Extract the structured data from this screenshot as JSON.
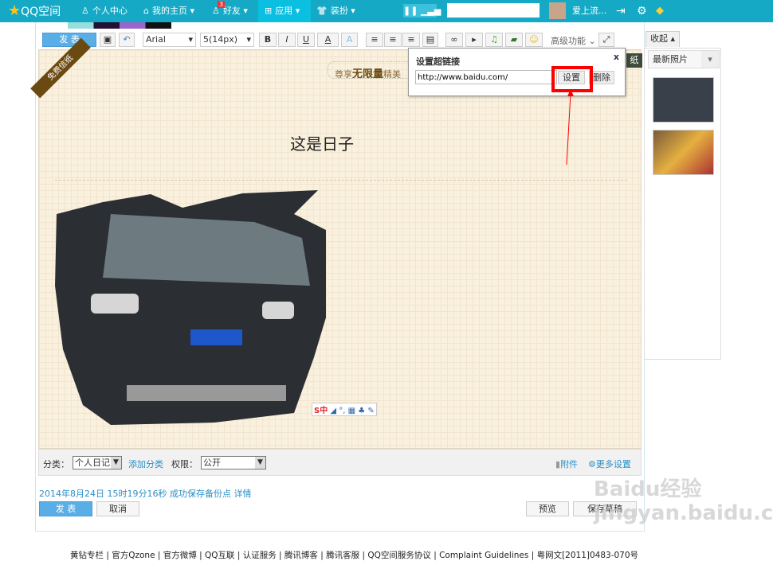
{
  "topbar": {
    "logo": "QQ空间",
    "nav": [
      {
        "label": "个人中心",
        "icon": "user-icon"
      },
      {
        "label": "我的主页 ▾",
        "icon": "home-icon"
      },
      {
        "label": "好友 ▾",
        "icon": "friends-icon",
        "badge": "3"
      },
      {
        "label": "应用 ▾",
        "icon": "apps-grid-icon",
        "active": true
      },
      {
        "label": "装扮 ▾",
        "icon": "tshirt-icon"
      }
    ],
    "username": "爱上流...",
    "search_value": ""
  },
  "toolbar": {
    "publish": "发 表",
    "font": "Arial",
    "size": "5(14px)",
    "bold": "B",
    "italic": "I",
    "underline": "U",
    "color": "A",
    "advanced": "高级功能 ⌄"
  },
  "paper": {
    "ribbon": "免费信纸",
    "promo_prefix": "尊享",
    "promo_bold": "无限量",
    "promo_suffix": "精美",
    "title": "这是日子",
    "right_tag": "纸"
  },
  "ime": {
    "label": "S中",
    "extra": "◢ °, ▦ ♣ ✎"
  },
  "dialog": {
    "title": "设置超链接",
    "close": "x",
    "url": "http://www.baidu.com/",
    "set": "设置",
    "delete": "删除"
  },
  "bottombar": {
    "category_label": "分类：",
    "category_value": "个人日记",
    "add_category": "添加分类",
    "permission_label": "权限：",
    "permission_value": "公开",
    "attachment": "附件",
    "more_settings": "更多设置"
  },
  "status": {
    "date": "2014年8月24日",
    "time": "15时19分16秒",
    "message": "成功保存备份点",
    "detail": "详情"
  },
  "actions": {
    "publish": "发 表",
    "cancel": "取消",
    "preview": "预览",
    "save_draft": "保存草稿"
  },
  "sidebar": {
    "collapse": "收起 ▴",
    "tab": "最新照片"
  },
  "footer": "黄钻专栏 | 官方Qzone | 官方微博 | QQ互联 | 认证服务 | 腾讯博客 | 腾讯客服 | QQ空间服务协议 | Complaint Guidelines | 粤网文[2011]0483-070号",
  "watermark": "Baidu经验 jingyan.baidu.com",
  "colors": {
    "topbar": "#15a9c5",
    "accent": "#2a8fc7",
    "highlight": "#ff0000",
    "publish": "#5aaee6"
  }
}
